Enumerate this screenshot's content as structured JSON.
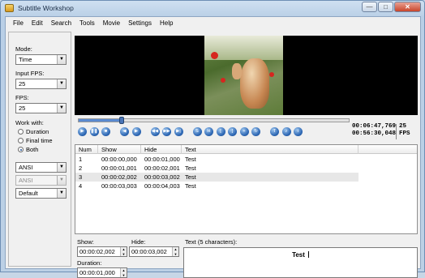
{
  "window": {
    "title": "Subtitle Workshop",
    "buttons": {
      "minimize": "—",
      "maximize": "□",
      "close": "✕"
    }
  },
  "menu": [
    "File",
    "Edit",
    "Search",
    "Tools",
    "Movie",
    "Settings",
    "Help"
  ],
  "left": {
    "mode_label": "Mode:",
    "mode_value": "Time",
    "input_fps_label": "Input FPS:",
    "input_fps_value": "25",
    "fps_label": "FPS:",
    "fps_value": "25",
    "work_with_label": "Work with:",
    "work_with_options": [
      "Duration",
      "Final time",
      "Both"
    ],
    "work_with_selected": "Both",
    "charset1": "ANSI",
    "charset2": "ANSI",
    "format": "Default"
  },
  "player": {
    "current_time": "00:06:47,769",
    "total_time": "00:56:30,048",
    "fps_value": "25",
    "fps_label": "FPS",
    "progress": 0.16
  },
  "table": {
    "columns": [
      "Num",
      "Show",
      "Hide",
      "Text"
    ],
    "rows": [
      {
        "num": "1",
        "show": "00:00:00,000",
        "hide": "00:00:01,000",
        "text": "Test"
      },
      {
        "num": "2",
        "show": "00:00:01,001",
        "hide": "00:00:02,001",
        "text": "Test"
      },
      {
        "num": "3",
        "show": "00:00:02,002",
        "hide": "00:00:03,002",
        "text": "Test"
      },
      {
        "num": "4",
        "show": "00:00:03,003",
        "hide": "00:00:04,003",
        "text": "Test"
      }
    ]
  },
  "editor": {
    "show_label": "Show:",
    "show_value": "00:00:02,002",
    "hide_label": "Hide:",
    "hide_value": "00:00:03,002",
    "duration_label": "Duration:",
    "duration_value": "00:00:01,000",
    "text_label": "Text (5 characters):",
    "text_value": "Test"
  }
}
